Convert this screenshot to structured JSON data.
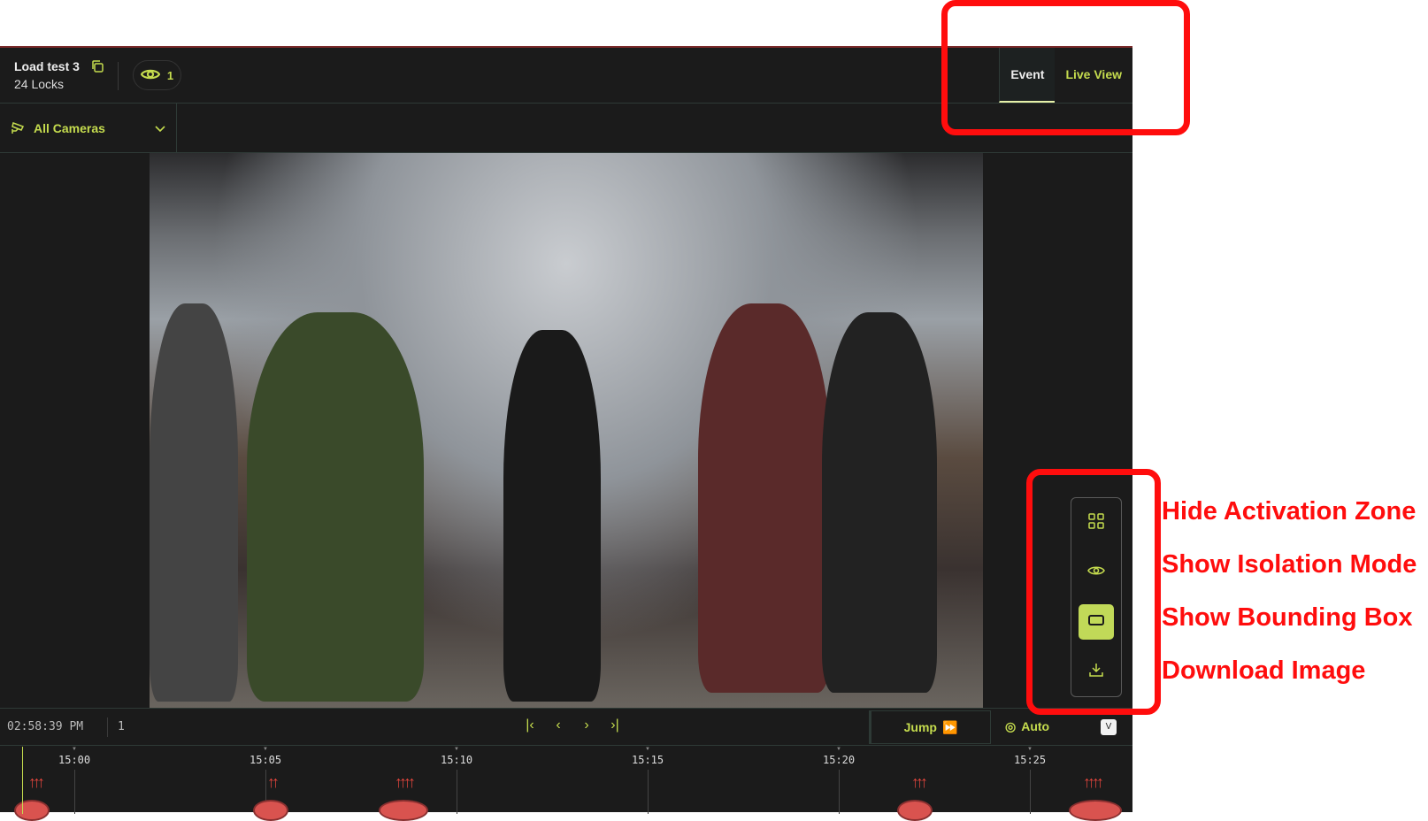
{
  "header": {
    "title": "Load test 3",
    "subtitle": "24 Locks",
    "viewers": "1"
  },
  "tabs": [
    {
      "label": "Event",
      "active": true
    },
    {
      "label": "Live View",
      "active": false
    }
  ],
  "camera_select": {
    "label": "All Cameras"
  },
  "controls": {
    "time": "02:58:39 PM",
    "count": "1",
    "jump": "Jump",
    "auto": "Auto",
    "key": "V"
  },
  "timeline": {
    "ticks": [
      "15:00",
      "15:05",
      "15:10",
      "15:15",
      "15:20",
      "15:25"
    ]
  },
  "annotations": [
    "Hide Activation Zone",
    "Show Isolation Mode",
    "Show Bounding Box",
    "Download Image"
  ],
  "colors": {
    "accent": "#c5dc4e",
    "annotation": "#ff0d0d",
    "background": "#1b1b1b"
  }
}
